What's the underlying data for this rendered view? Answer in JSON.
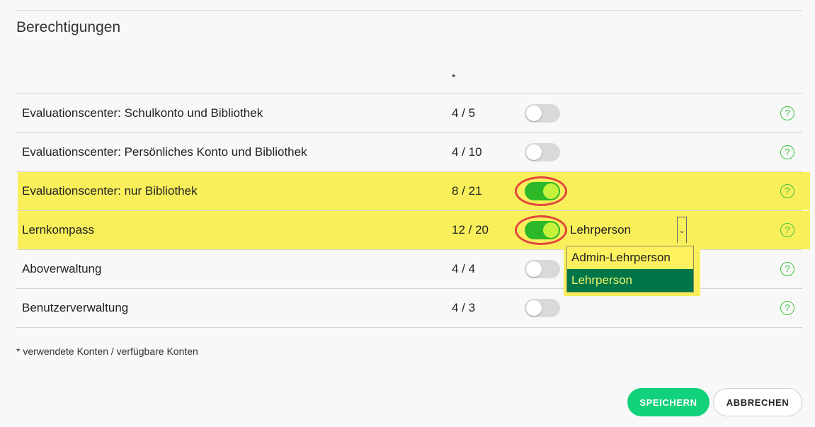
{
  "section": {
    "title": "Berechtigungen",
    "column_marker": "*"
  },
  "permissions": [
    {
      "label": "Evaluationscenter: Schulkonto und Bibliothek",
      "count": "4 / 5",
      "enabled": false,
      "highlighted": false
    },
    {
      "label": "Evaluationscenter: Persönliches Konto und Bibliothek",
      "count": "4 / 10",
      "enabled": false,
      "highlighted": false
    },
    {
      "label": "Evaluationscenter: nur Bibliothek",
      "count": "8 / 21",
      "enabled": true,
      "highlighted": true
    },
    {
      "label": "Lernkompass",
      "count": "12 / 20",
      "enabled": true,
      "highlighted": true,
      "role_select": {
        "value": "Lehrperson"
      }
    },
    {
      "label": "Aboverwaltung",
      "count": "4 / 4",
      "enabled": false,
      "highlighted": false
    },
    {
      "label": "Benutzerverwaltung",
      "count": "4 / 3",
      "enabled": false,
      "highlighted": false
    }
  ],
  "role_dropdown": {
    "options": [
      "Admin-Lehrperson",
      "Lehrperson"
    ],
    "selected": "Lehrperson"
  },
  "help_icon": "?",
  "footnote": "* verwendete Konten / verfügbare Konten",
  "buttons": {
    "save_label": "SPEICHERN",
    "cancel_label": "ABBRECHEN"
  },
  "colors": {
    "highlight": "#f9ef5b",
    "toggle_on": "#2db82a",
    "annotation_ring": "#e0463c",
    "save_button": "#11d17b",
    "dropdown_selected": "#007548"
  }
}
